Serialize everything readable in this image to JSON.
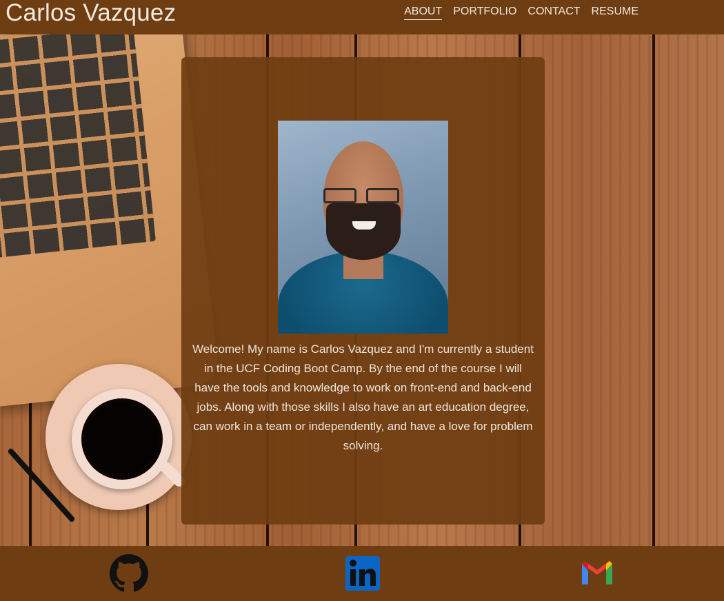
{
  "header": {
    "title": "Carlos Vazquez",
    "nav": [
      {
        "label": "ABOUT",
        "active": true
      },
      {
        "label": "PORTFOLIO",
        "active": false
      },
      {
        "label": "CONTACT",
        "active": false
      },
      {
        "label": "RESUME",
        "active": false
      }
    ]
  },
  "about": {
    "welcome_text": "Welcome! My name is Carlos Vazquez and I'm currently a student in the UCF Coding Boot Camp. By the end of the course I will have the tools and knowledge to work on front-end and back-end jobs. Along with those skills I also have an art education degree, can work in a team or independently, and have a love for problem solving."
  },
  "footer": {
    "icons": [
      "github-icon",
      "linkedin-icon",
      "gmail-icon"
    ]
  },
  "colors": {
    "brand_brown": "#6f3d12",
    "text_light": "#f1e9df",
    "linkedin_blue": "#0a66c2"
  }
}
